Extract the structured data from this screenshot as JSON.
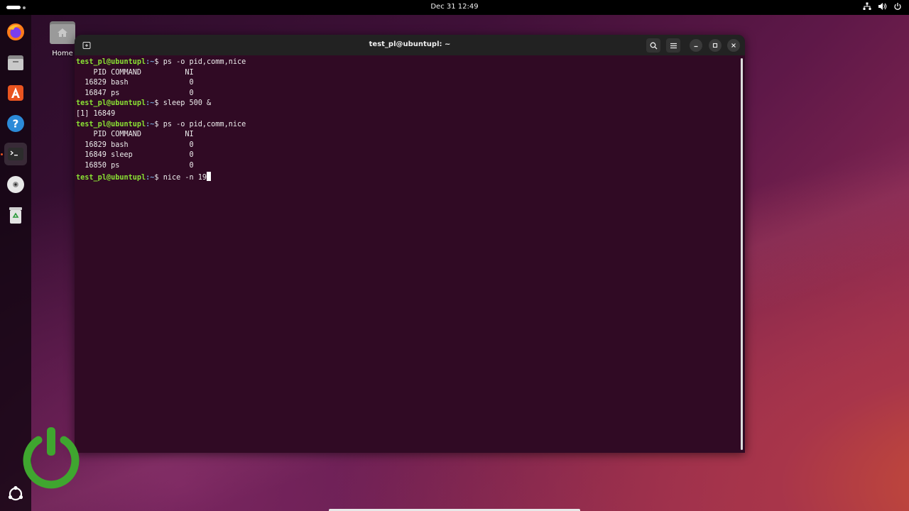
{
  "topbar": {
    "clock": "Dec 31  12:49",
    "icons": [
      "network-icon",
      "volume-icon",
      "power-icon"
    ]
  },
  "dock": {
    "items": [
      {
        "name": "firefox",
        "icon": "firefox-icon"
      },
      {
        "name": "files",
        "icon": "files-icon"
      },
      {
        "name": "app-center",
        "icon": "app-center-icon"
      },
      {
        "name": "help",
        "icon": "help-icon"
      },
      {
        "name": "terminal",
        "icon": "terminal-icon",
        "active": true
      },
      {
        "name": "disc",
        "icon": "disc-icon"
      },
      {
        "name": "trash",
        "icon": "trash-icon"
      },
      {
        "name": "show-apps",
        "icon": "ubuntu-icon"
      }
    ]
  },
  "desktop": {
    "home_label": "Home"
  },
  "terminal": {
    "title": "test_pl@ubuntupl: ~",
    "prompt_user": "test_pl@ubuntupl",
    "prompt_path": ":~",
    "prompt_symbol": "$ ",
    "lines": [
      {
        "type": "prompt",
        "cmd": "ps -o pid,comm,nice"
      },
      {
        "type": "out",
        "text": "    PID COMMAND          NI"
      },
      {
        "type": "out",
        "text": "  16829 bash              0"
      },
      {
        "type": "out",
        "text": "  16847 ps                0"
      },
      {
        "type": "prompt",
        "cmd": "sleep 500 &"
      },
      {
        "type": "out",
        "text": "[1] 16849"
      },
      {
        "type": "prompt",
        "cmd": "ps -o pid,comm,nice"
      },
      {
        "type": "out",
        "text": "    PID COMMAND          NI"
      },
      {
        "type": "out",
        "text": "  16829 bash              0"
      },
      {
        "type": "out",
        "text": "  16849 sleep             0"
      },
      {
        "type": "out",
        "text": "  16850 ps                0"
      },
      {
        "type": "prompt",
        "cmd": "nice -n 19",
        "cursor": true
      }
    ]
  },
  "colors": {
    "terminal_bg": "#300a24",
    "prompt_user": "#8ae234",
    "prompt_path": "#729fcf",
    "accent": "#e95420"
  }
}
